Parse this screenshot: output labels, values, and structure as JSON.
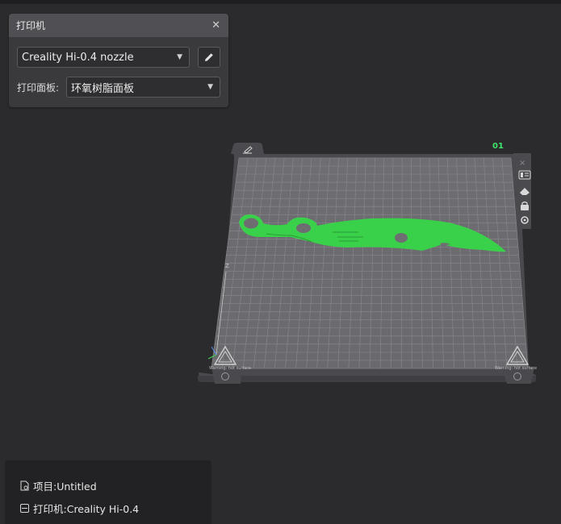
{
  "printer_panel": {
    "title": "打印机",
    "nozzle_value": "Creality Hi-0.4 nozzle",
    "plate_label": "打印面板:",
    "plate_value": "环氧树脂面板"
  },
  "viewport": {
    "plate_number": "01",
    "warning_left": "Warning: hot surface",
    "warning_right": "Warning: hot surface",
    "model_color": "#3ad14a",
    "plate_number_color": "#3fe36a",
    "plate_tools": [
      "list-icon",
      "eraser-icon",
      "lock-icon",
      "gear-icon"
    ]
  },
  "info_panel": {
    "project": "项目:Untitled",
    "printer": "打印机:Creality Hi-0.4"
  }
}
